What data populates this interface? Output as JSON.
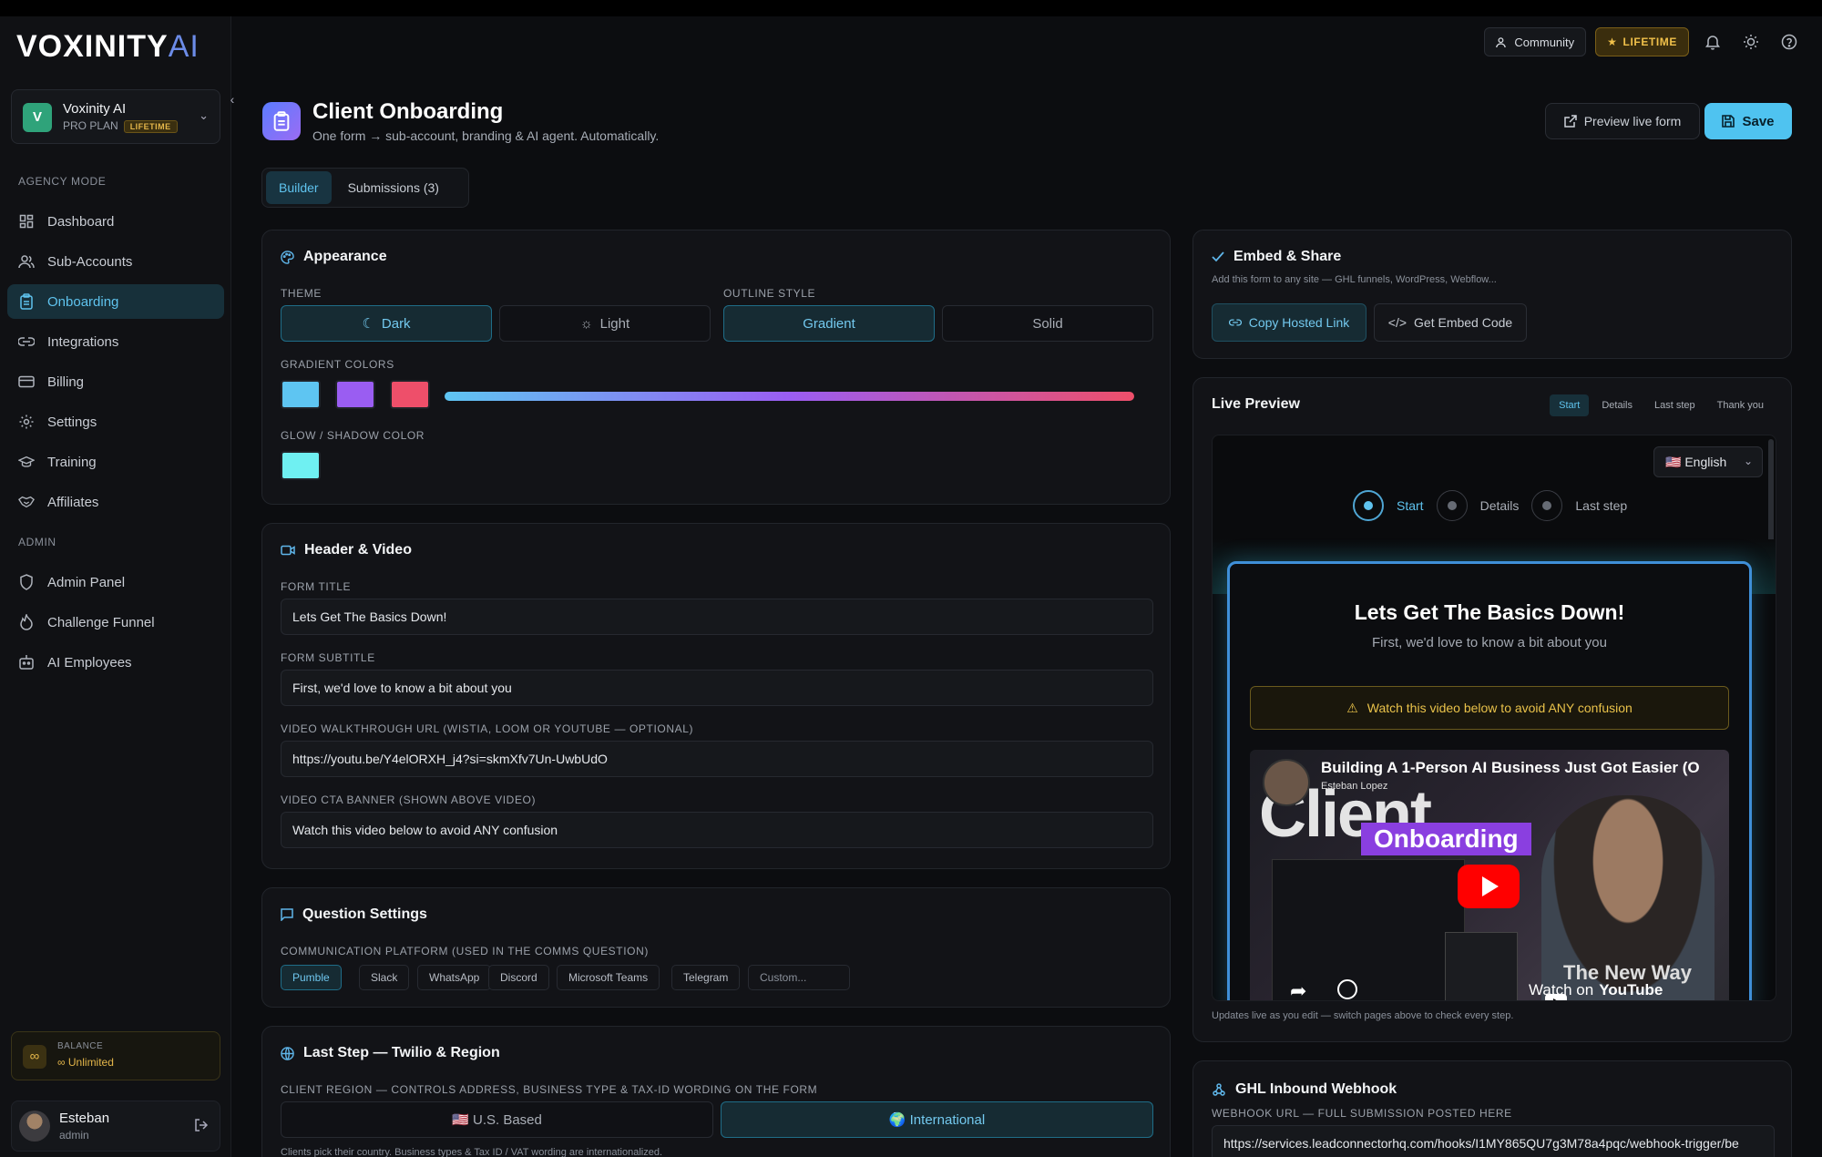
{
  "app": {
    "logo_main": "VOXINITY",
    "logo_ai": "AI",
    "workspace": {
      "avatar": "V",
      "name": "Voxinity AI",
      "plan": "PRO PLAN",
      "badge": "LIFETIME"
    }
  },
  "sidebar": {
    "agency_label": "AGENCY MODE",
    "agency_items": [
      {
        "label": "Dashboard",
        "icon": "grid-icon"
      },
      {
        "label": "Sub-Accounts",
        "icon": "users-icon"
      },
      {
        "label": "Onboarding",
        "icon": "clipboard-icon",
        "active": true
      },
      {
        "label": "Integrations",
        "icon": "link-icon"
      },
      {
        "label": "Billing",
        "icon": "credit-card-icon"
      },
      {
        "label": "Settings",
        "icon": "gear-icon"
      },
      {
        "label": "Training",
        "icon": "graduation-cap-icon"
      },
      {
        "label": "Affiliates",
        "icon": "handshake-icon"
      }
    ],
    "admin_label": "ADMIN",
    "admin_items": [
      {
        "label": "Admin Panel",
        "icon": "shield-icon"
      },
      {
        "label": "Challenge Funnel",
        "icon": "flame-icon"
      },
      {
        "label": "AI Employees",
        "icon": "bot-icon"
      }
    ],
    "balance": {
      "label": "BALANCE",
      "value": "Unlimited"
    },
    "user": {
      "name": "Esteban",
      "role": "admin"
    }
  },
  "topbar": {
    "community": "Community",
    "lifetime": "LIFETIME"
  },
  "page": {
    "title": "Client Onboarding",
    "subtitle": "One form → sub-account, branding & AI agent. Automatically.",
    "preview_label": "Preview live form",
    "save_label": "Save",
    "tabs": [
      "Builder",
      "Submissions (3)"
    ]
  },
  "appearance": {
    "title": "Appearance",
    "theme_label": "THEME",
    "theme_options": [
      "Dark",
      "Light"
    ],
    "outline_label": "OUTLINE STYLE",
    "outline_options": [
      "Gradient",
      "Solid"
    ],
    "gradient_label": "GRADIENT COLORS",
    "gradient_colors": [
      "#5ec5f2",
      "#9a5df2",
      "#ee4f6a"
    ],
    "glow_label": "GLOW / SHADOW COLOR",
    "glow_color": "#6ff0f2"
  },
  "header_video": {
    "title": "Header & Video",
    "form_title_label": "FORM TITLE",
    "form_title": "Lets Get The Basics Down!",
    "form_subtitle_label": "FORM SUBTITLE",
    "form_subtitle": "First, we'd love to know a bit about you",
    "video_url_label": "VIDEO WALKTHROUGH URL (WISTIA, LOOM OR YOUTUBE — OPTIONAL)",
    "video_url": "https://youtu.be/Y4elORXH_j4?si=skmXfv7Un-UwbUdO",
    "cta_label": "VIDEO CTA BANNER (SHOWN ABOVE VIDEO)",
    "cta": "Watch this video below to avoid ANY confusion"
  },
  "question_settings": {
    "title": "Question Settings",
    "platform_label": "COMMUNICATION PLATFORM (USED IN THE COMMS QUESTION)",
    "platforms": [
      "Pumble",
      "Slack",
      "WhatsApp",
      "Discord",
      "Microsoft Teams",
      "Telegram"
    ],
    "custom_placeholder": "Custom..."
  },
  "last_step": {
    "title": "Last Step — Twilio & Region",
    "region_label": "CLIENT REGION — CONTROLS ADDRESS, BUSINESS TYPE & TAX-ID WORDING ON THE FORM",
    "regions": [
      "🇺🇸 U.S. Based",
      "🌍 International"
    ],
    "note": "Clients pick their country. Business types & Tax ID / VAT wording are internationalized."
  },
  "embed": {
    "title": "Embed & Share",
    "subtitle": "Add this form to any site — GHL funnels, WordPress, Webflow...",
    "copy_label": "Copy Hosted Link",
    "embed_label": "Get Embed Code"
  },
  "live_preview": {
    "title": "Live Preview",
    "tabs": [
      "Start",
      "Details",
      "Last step",
      "Thank you"
    ],
    "language": "🇺🇸 English",
    "steps": [
      "Start",
      "Details",
      "Last step"
    ],
    "video": {
      "title": "Building A 1-Person AI Business Just Got Easier (O",
      "channel": "Esteban Lopez",
      "big_text": "Client",
      "highlight": "Onboarding",
      "tagline": "The New Way",
      "watch_on": "Watch on",
      "youtube": "YouTube"
    },
    "note": "Updates live as you edit — switch pages above to check every step."
  },
  "webhook": {
    "title": "GHL Inbound Webhook",
    "url_label": "WEBHOOK URL — FULL SUBMISSION POSTED HERE",
    "url": "https://services.leadconnectorhq.com/hooks/I1MY865QU7g3M78a4pqc/webhook-trigger/be"
  }
}
